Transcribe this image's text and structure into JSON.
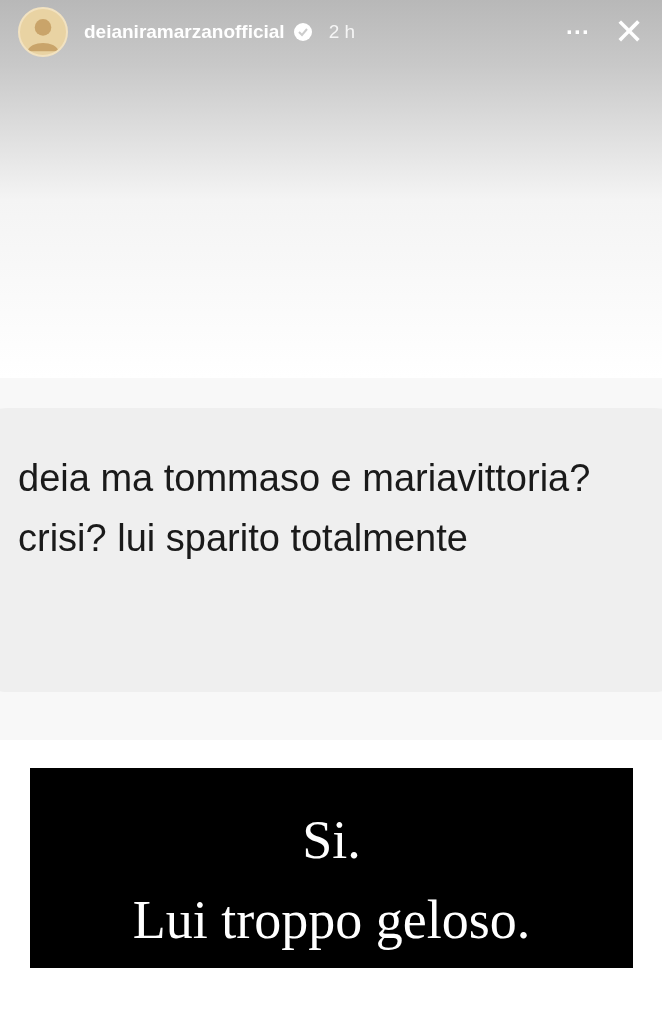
{
  "header": {
    "username": "deianiramarzanofficial",
    "verified": true,
    "time": "2 h",
    "more": "···",
    "close": "✕"
  },
  "question": {
    "text": "deia ma tommaso e mariavittoria? crisi? lui sparito totalmente"
  },
  "answer": {
    "lines": [
      "Si.",
      "Lui troppo geloso."
    ]
  }
}
